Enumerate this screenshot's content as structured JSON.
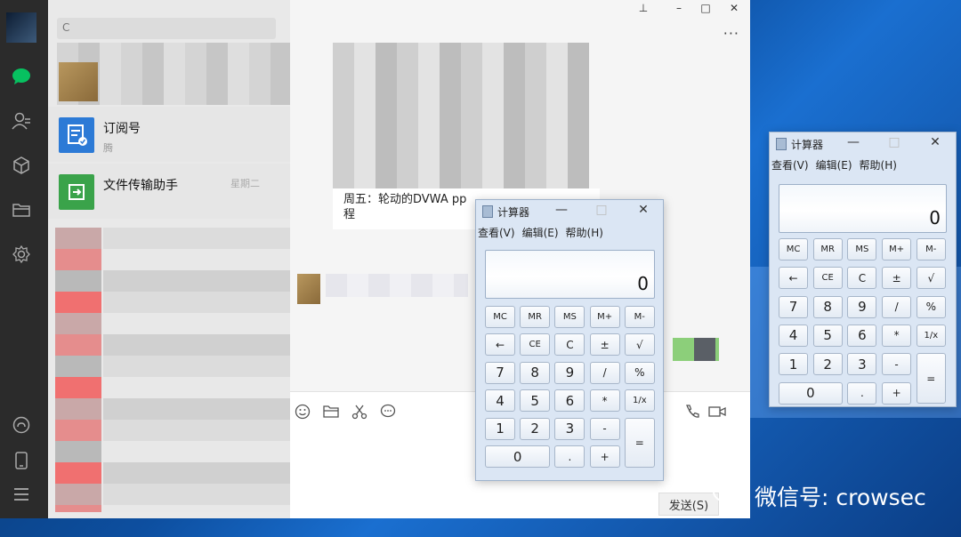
{
  "wechat": {
    "search_placeholder": "C",
    "chats": [
      {
        "title": "订阅号",
        "subtitle": "腾",
        "time": ""
      },
      {
        "title": "文件传输助手",
        "subtitle": "",
        "time": "星期二"
      }
    ],
    "message_fragment": "周五：轮动的DVWA pp\n程",
    "more_label": "···",
    "send_label": "发送(S)",
    "window_controls": {
      "pin": "⊥",
      "minimize": "–",
      "maximize": "□",
      "close": "✕"
    },
    "rail_icons": [
      "chat-icon",
      "contacts-icon",
      "cube-icon",
      "folder-icon",
      "gear-icon",
      "mini-program-icon",
      "phone-icon",
      "menu-icon"
    ],
    "tool_icons": [
      "emoji-icon",
      "folder-icon",
      "scissors-icon",
      "chat-bubble-icon",
      "phone-icon",
      "video-icon"
    ]
  },
  "calc_small": {
    "title": "计算器",
    "menu": [
      "查看(V)",
      "编辑(E)",
      "帮助(H)"
    ],
    "display": "0",
    "controls": {
      "minimize": "—",
      "maximize": "□",
      "close": "✕"
    }
  },
  "calc_large": {
    "title": "计算器",
    "menu": [
      "查看(V)",
      "编辑(E)",
      "帮助(H)"
    ],
    "display": "0",
    "controls": {
      "minimize": "—",
      "maximize": "□",
      "close": "✕"
    }
  },
  "calc_keys": {
    "row1": [
      "MC",
      "MR",
      "MS",
      "M+",
      "M-"
    ],
    "row2": [
      "←",
      "CE",
      "C",
      "±",
      "√"
    ],
    "row3": [
      "7",
      "8",
      "9",
      "/",
      "%"
    ],
    "row4": [
      "4",
      "5",
      "6",
      "*",
      "1/x"
    ],
    "row5": [
      "1",
      "2",
      "3",
      "-",
      "="
    ],
    "row6": [
      "0",
      ".",
      "+"
    ]
  },
  "watermark": "微信号: crowsec",
  "colors": {
    "wechat_green": "#07c160",
    "rail": "#2b2b2b",
    "subscription_blue": "#2c7ad6",
    "file_green": "#3aa34a"
  }
}
